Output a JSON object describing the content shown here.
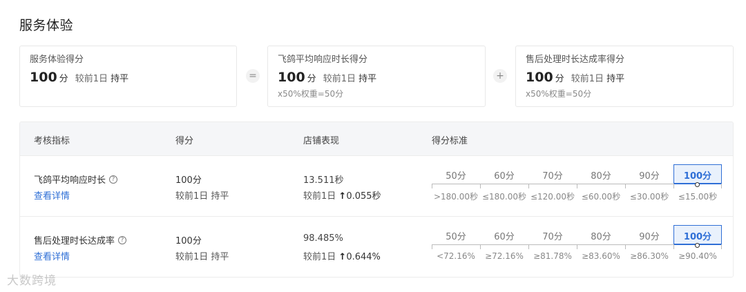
{
  "page": {
    "title": "服务体验"
  },
  "cards": [
    {
      "label": "服务体验得分",
      "score": "100",
      "unit": "分",
      "compare_prefix": "较前1日",
      "compare_value": "持平",
      "weight": ""
    },
    {
      "label": "飞鸽平均响应时长得分",
      "score": "100",
      "unit": "分",
      "compare_prefix": "较前1日",
      "compare_value": "持平",
      "weight": "x50%权重=50分"
    },
    {
      "label": "售后处理时长达成率得分",
      "score": "100",
      "unit": "分",
      "compare_prefix": "较前1日",
      "compare_value": "持平",
      "weight": "x50%权重=50分"
    }
  ],
  "operators": {
    "equals": "=",
    "plus": "+"
  },
  "table": {
    "headers": [
      "考核指标",
      "得分",
      "店铺表现",
      "得分标准"
    ],
    "rows": [
      {
        "name": "飞鸽平均响应时长",
        "help_icon": "question-circle-icon",
        "detail_link": "查看详情",
        "score": "100分",
        "score_compare": "较前1日 持平",
        "performance": "13.511秒",
        "perf_compare_prefix": "较前1日",
        "perf_arrow": "↑",
        "perf_delta": "0.055秒",
        "scale": [
          {
            "score": "50分",
            "range": ">180.00秒"
          },
          {
            "score": "60分",
            "range": "≤180.00秒"
          },
          {
            "score": "70分",
            "range": "≤120.00秒"
          },
          {
            "score": "80分",
            "range": "≤60.00秒"
          },
          {
            "score": "90分",
            "range": "≤30.00秒"
          },
          {
            "score": "100分",
            "range": "≤15.00秒"
          }
        ],
        "active_index": 5
      },
      {
        "name": "售后处理时长达成率",
        "help_icon": "question-circle-icon",
        "detail_link": "查看详情",
        "score": "100分",
        "score_compare": "较前1日 持平",
        "performance": "98.485%",
        "perf_compare_prefix": "较前1日",
        "perf_arrow": "↑",
        "perf_delta": "0.644%",
        "scale": [
          {
            "score": "50分",
            "range": "<72.16%"
          },
          {
            "score": "60分",
            "range": "≥72.16%"
          },
          {
            "score": "70分",
            "range": "≥81.78%"
          },
          {
            "score": "80分",
            "range": "≥83.60%"
          },
          {
            "score": "90分",
            "range": "≥86.30%"
          },
          {
            "score": "100分",
            "range": "≥90.40%"
          }
        ],
        "active_index": 5
      }
    ]
  },
  "watermark": "大数跨境",
  "colors": {
    "accent": "#2f6fd6",
    "active_bg": "#e9f1fc",
    "header_bg": "#f5f6f8"
  }
}
